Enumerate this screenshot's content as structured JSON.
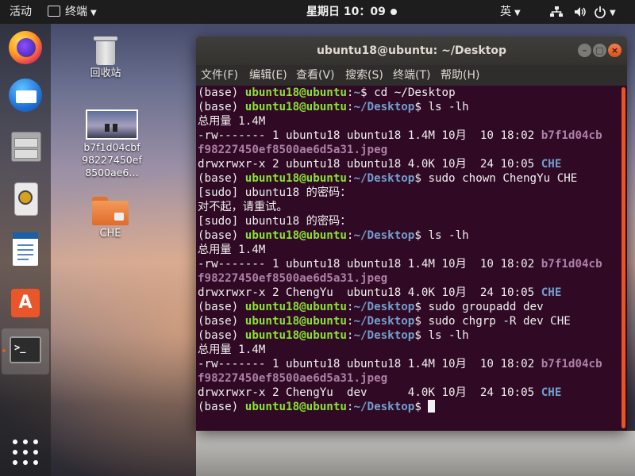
{
  "topbar": {
    "activities": "活动",
    "app_menu": "终端",
    "clock": "星期日 10：09",
    "input_method": "英",
    "colors": {
      "background": "#1d1d1d",
      "text": "#eeeeee"
    }
  },
  "dock": {
    "items": [
      "firefox-icon",
      "thunderbird-icon",
      "files-icon",
      "rhythmbox-icon",
      "libreoffice-writer-icon",
      "ubuntu-software-icon",
      "terminal-icon",
      "show-applications-icon"
    ],
    "active": "terminal-icon"
  },
  "desktop": {
    "trash_label": "回收站",
    "jpeg_label_lines": [
      "b7f1d04cbf",
      "98227450ef",
      "8500ae6…"
    ],
    "folder_label": "CHE"
  },
  "window": {
    "title": "ubuntu18@ubuntu: ~/Desktop",
    "menu": [
      "文件(F)",
      "编辑(E)",
      "查看(V)",
      "搜索(S)",
      "终端(T)",
      "帮助(H)"
    ],
    "controls": {
      "minimize": "–",
      "maximize": "□",
      "close": "×"
    }
  },
  "terminal": {
    "colors": {
      "background": "#300a24",
      "user": "#8ae234",
      "path": "#729fcf",
      "image_file": "#ad7fa8",
      "scrollbar": "#e95420"
    },
    "env": "(base) ",
    "user": "ubuntu18@ubuntu",
    "lines": [
      {
        "type": "prompt",
        "path": "~",
        "cmd": "cd ~/Desktop"
      },
      {
        "type": "prompt",
        "path": "~/Desktop",
        "cmd": "ls -lh"
      },
      {
        "type": "out",
        "text": "总用量 1.4M"
      },
      {
        "type": "file",
        "meta": "-rw------- 1 ubuntu18 ubuntu18 1.4M 10月  10 18:02 ",
        "name": "b7f1d04cb"
      },
      {
        "type": "file",
        "meta": "",
        "name": "f98227450ef8500ae6d5a31.jpeg"
      },
      {
        "type": "dir",
        "meta": "drwxrwxr-x 2 ubuntu18 ubuntu18 4.0K 10月  24 10:05 ",
        "name": "CHE"
      },
      {
        "type": "prompt",
        "path": "~/Desktop",
        "cmd": "sudo chown ChengYu CHE"
      },
      {
        "type": "out",
        "text": "[sudo] ubuntu18 的密码："
      },
      {
        "type": "out",
        "text": "对不起，请重试。"
      },
      {
        "type": "out",
        "text": "[sudo] ubuntu18 的密码："
      },
      {
        "type": "prompt",
        "path": "~/Desktop",
        "cmd": "ls -lh"
      },
      {
        "type": "out",
        "text": "总用量 1.4M"
      },
      {
        "type": "file",
        "meta": "-rw------- 1 ubuntu18 ubuntu18 1.4M 10月  10 18:02 ",
        "name": "b7f1d04cb"
      },
      {
        "type": "file",
        "meta": "",
        "name": "f98227450ef8500ae6d5a31.jpeg"
      },
      {
        "type": "dir",
        "meta": "drwxrwxr-x 2 ChengYu  ubuntu18 4.0K 10月  24 10:05 ",
        "name": "CHE"
      },
      {
        "type": "prompt",
        "path": "~/Desktop",
        "cmd": "sudo groupadd dev"
      },
      {
        "type": "prompt",
        "path": "~/Desktop",
        "cmd": "sudo chgrp -R dev CHE"
      },
      {
        "type": "prompt",
        "path": "~/Desktop",
        "cmd": "ls -lh"
      },
      {
        "type": "out",
        "text": "总用量 1.4M"
      },
      {
        "type": "file",
        "meta": "-rw------- 1 ubuntu18 ubuntu18 1.4M 10月  10 18:02 ",
        "name": "b7f1d04cb"
      },
      {
        "type": "file",
        "meta": "",
        "name": "f98227450ef8500ae6d5a31.jpeg"
      },
      {
        "type": "dir",
        "meta": "drwxrwxr-x 2 ChengYu  dev      4.0K 10月  24 10:05 ",
        "name": "CHE"
      },
      {
        "type": "current",
        "path": "~/Desktop",
        "cmd": ""
      }
    ]
  }
}
